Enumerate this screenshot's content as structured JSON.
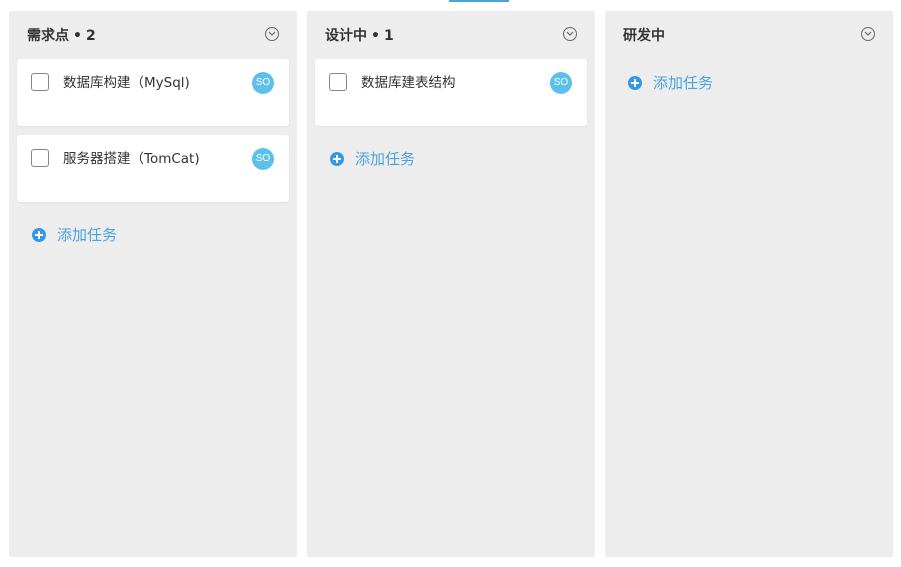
{
  "columns": [
    {
      "title": "需求点",
      "separator": "•",
      "count": "2",
      "cards": [
        {
          "title": "数据库构建（MySql)",
          "avatar": "SO"
        },
        {
          "title": "服务器搭建（TomCat)",
          "avatar": "SO"
        }
      ],
      "add_label": "添加任务"
    },
    {
      "title": "设计中",
      "separator": "•",
      "count": "1",
      "cards": [
        {
          "title": "数据库建表结构",
          "avatar": "SO"
        }
      ],
      "add_label": "添加任务"
    },
    {
      "title": "研发中",
      "separator": "",
      "count": "",
      "cards": [],
      "add_label": "添加任务"
    }
  ],
  "icons": {
    "collapse": "chevron-down-circle-icon",
    "add": "plus-circle-icon"
  },
  "colors": {
    "column_bg": "#ededed",
    "accent": "#4aa3df",
    "avatar_bg": "#5bc0eb",
    "add_icon": "#3399e6"
  }
}
